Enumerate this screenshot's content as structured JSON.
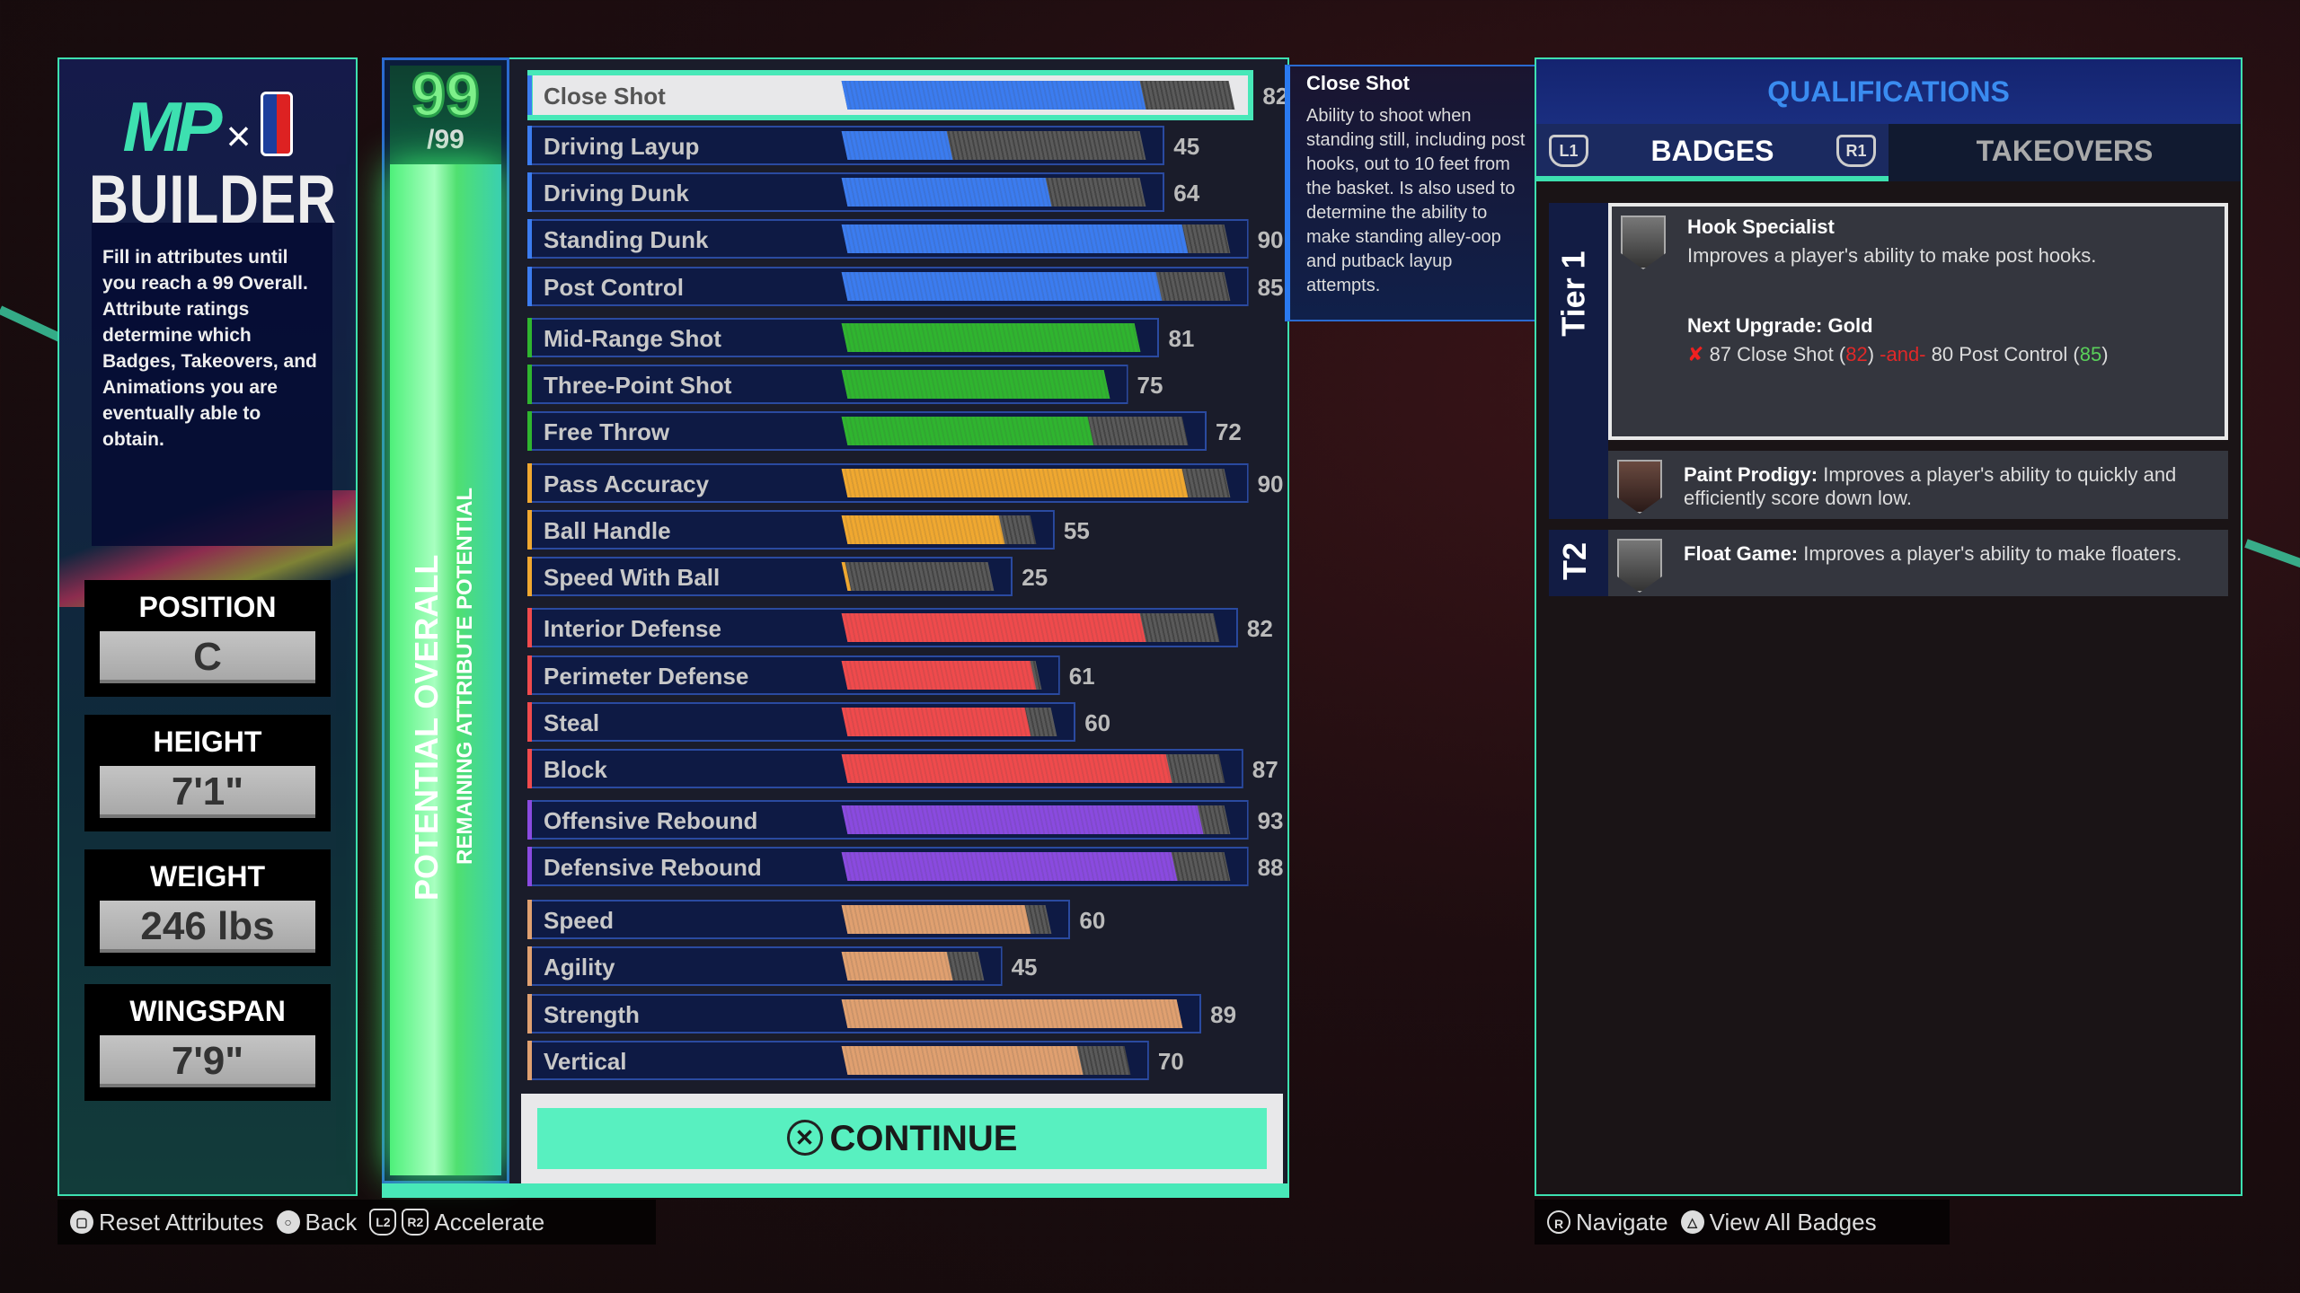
{
  "builder": {
    "logo_text": "MP",
    "title": "BUILDER",
    "description": "Fill in attributes until you reach a 99 Overall. Attribute ratings determine which Badges, Takeovers, and Animations you are eventually able to obtain.",
    "info": [
      {
        "label": "POSITION",
        "value": "C"
      },
      {
        "label": "HEIGHT",
        "value": "7'1\""
      },
      {
        "label": "WEIGHT",
        "value": "246 lbs"
      },
      {
        "label": "WINGSPAN",
        "value": "7'9\""
      }
    ]
  },
  "overall": {
    "value": "99",
    "max": "/99",
    "label_potential": "POTENTIAL OVERALL",
    "label_remaining": "REMAINING ATTRIBUTE POTENTIAL",
    "remaining_fraction": 1.0
  },
  "colors": {
    "inside": "#3b7cf0",
    "shooting": "#2fb52f",
    "playmaking": "#f0a830",
    "defense": "#f04a4c",
    "rebounding": "#8a4ae0",
    "physicals": "#e0a070",
    "accent": "#3de0b0"
  },
  "attributes": [
    {
      "name": "Close Shot",
      "value": 82,
      "cap": 99,
      "group": "inside",
      "selected": true
    },
    {
      "name": "Driving Layup",
      "value": 45,
      "cap": 82,
      "group": "inside"
    },
    {
      "name": "Driving Dunk",
      "value": 64,
      "cap": 82,
      "group": "inside"
    },
    {
      "name": "Standing Dunk",
      "value": 90,
      "cap": 98,
      "group": "inside"
    },
    {
      "name": "Post Control",
      "value": 85,
      "cap": 98,
      "group": "inside"
    },
    {
      "name": "Mid-Range Shot",
      "value": 81,
      "cap": 81,
      "group": "shooting"
    },
    {
      "name": "Three-Point Shot",
      "value": 75,
      "cap": 75,
      "group": "shooting"
    },
    {
      "name": "Free Throw",
      "value": 72,
      "cap": 90,
      "group": "shooting"
    },
    {
      "name": "Pass Accuracy",
      "value": 90,
      "cap": 98,
      "group": "playmaking"
    },
    {
      "name": "Ball Handle",
      "value": 55,
      "cap": 61,
      "group": "playmaking"
    },
    {
      "name": "Speed With Ball",
      "value": 25,
      "cap": 53,
      "group": "playmaking"
    },
    {
      "name": "Interior Defense",
      "value": 82,
      "cap": 96,
      "group": "defense"
    },
    {
      "name": "Perimeter Defense",
      "value": 61,
      "cap": 62,
      "group": "defense"
    },
    {
      "name": "Steal",
      "value": 60,
      "cap": 65,
      "group": "defense"
    },
    {
      "name": "Block",
      "value": 87,
      "cap": 97,
      "group": "defense"
    },
    {
      "name": "Offensive Rebound",
      "value": 93,
      "cap": 98,
      "group": "rebounding"
    },
    {
      "name": "Defensive Rebound",
      "value": 88,
      "cap": 98,
      "group": "rebounding"
    },
    {
      "name": "Speed",
      "value": 60,
      "cap": 64,
      "group": "physicals"
    },
    {
      "name": "Agility",
      "value": 45,
      "cap": 51,
      "group": "physicals"
    },
    {
      "name": "Strength",
      "value": 89,
      "cap": 89,
      "group": "physicals"
    },
    {
      "name": "Vertical",
      "value": 70,
      "cap": 79,
      "group": "physicals"
    }
  ],
  "continue": {
    "glyph": "✕",
    "label": "CONTINUE"
  },
  "tooltip": {
    "title": "Close Shot",
    "text": "Ability to shoot when standing still, including post hooks, out to 10 feet from the basket. Is also used to determine the ability to make standing alley-oop and putback layup attempts."
  },
  "qualifications": {
    "title": "QUALIFICATIONS",
    "tabs": [
      {
        "label": "BADGES",
        "active": true
      },
      {
        "label": "TAKEOVERS"
      }
    ],
    "tab_buttons": {
      "left": "L1",
      "right": "R1"
    },
    "tiers": {
      "tier1": "Tier 1",
      "tier2": "T2"
    },
    "badges": [
      {
        "name": "Hook Specialist",
        "desc": "Improves a player's ability to make post hooks.",
        "next_upgrade": "Next Upgrade: Gold",
        "req": {
          "fail_icon": "✘",
          "a": "87 Close Shot (",
          "a_cur": "82",
          "joiner": "-and-",
          "b": "80 Post Control (",
          "b_cur": "85",
          "close": ")"
        }
      },
      {
        "name": "Paint Prodigy:",
        "desc": "Improves a player's ability to quickly and efficiently score down low."
      },
      {
        "name": "Float Game:",
        "desc": "Improves a player's ability to make floaters."
      }
    ]
  },
  "footer_left": [
    {
      "glyph": "▢",
      "label": "Reset Attributes"
    },
    {
      "glyph": "○",
      "label": "Back"
    },
    {
      "glyph": "L2",
      "glyph2": "R2",
      "label": "Accelerate"
    }
  ],
  "footer_right": [
    {
      "glyph": "R",
      "label": "Navigate"
    },
    {
      "glyph": "△",
      "label": "View All Badges"
    }
  ]
}
